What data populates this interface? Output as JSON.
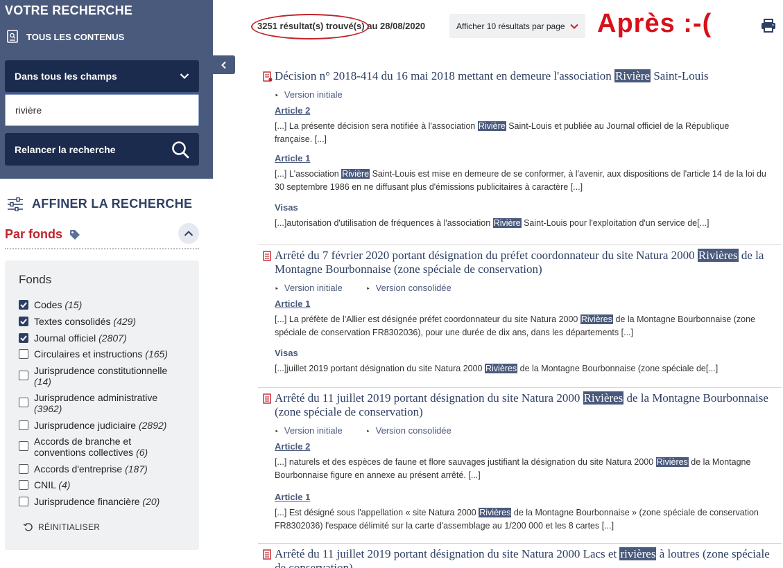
{
  "sidebar": {
    "title": "VOTRE RECHERCHE",
    "scope_label": "TOUS LES CONTENUS",
    "field_select": "Dans tous les champs",
    "query": "rivière",
    "relaunch_label": "Relancer la recherche",
    "refine_title": "AFFINER LA RECHERCHE",
    "section_title": "Par fonds",
    "fonds_title": "Fonds",
    "fonds": [
      {
        "label": "Codes",
        "count": "(15)",
        "checked": true
      },
      {
        "label": "Textes consolidés",
        "count": "(429)",
        "checked": true
      },
      {
        "label": "Journal officiel",
        "count": "(2807)",
        "checked": true
      },
      {
        "label": "Circulaires et instructions",
        "count": "(165)",
        "checked": false
      },
      {
        "label": "Jurisprudence constitutionnelle",
        "count": "(14)",
        "checked": false
      },
      {
        "label": "Jurisprudence administrative",
        "count": "(3962)",
        "checked": false
      },
      {
        "label": "Jurisprudence judiciaire",
        "count": "(2892)",
        "checked": false
      },
      {
        "label": "Accords de branche et conventions collectives",
        "count": "(6)",
        "checked": false
      },
      {
        "label": "Accords d'entreprise",
        "count": "(187)",
        "checked": false
      },
      {
        "label": "CNIL",
        "count": "(4)",
        "checked": false
      },
      {
        "label": "Jurisprudence financière",
        "count": "(20)",
        "checked": false
      }
    ],
    "reset_label": "RÉINITIALISER"
  },
  "topbar": {
    "count_text": "3251 résultat(s) trouvé(s)",
    "date_text": " au 28/08/2020",
    "per_page": "Afficher 10 résultats par page",
    "annotation": "Après :-("
  },
  "results": [
    {
      "title_a": "Décision n° 2018-414 du 16 mai 2018 mettant en demeure l'association ",
      "title_hl": "Rivière",
      "title_b": " Saint-Louis",
      "versions": [
        "Version initiale"
      ],
      "sections": [
        {
          "label": "Article 2",
          "type": "article",
          "a": "[...] La présente décision sera notifiée à l'association ",
          "hl": "Rivière",
          "b": " Saint-Louis et publiée au Journal officiel de la République française. [...]"
        },
        {
          "label": "Article 1",
          "type": "article",
          "a": "[...] L'association ",
          "hl": "Rivière",
          "b": " Saint-Louis est mise en demeure de se conformer, à l'avenir, aux dispositions de l'article 14 de la loi du 30 septembre 1986 en ne diffusant plus d'émissions publicitaires à caractère [...]"
        },
        {
          "label": "Visas",
          "type": "visa",
          "a": "[...]autorisation d'utilisation de fréquences à l'association ",
          "hl": "Rivière",
          "b": " Saint-Louis pour l'exploitation d'un service de[...]"
        }
      ]
    },
    {
      "title_a": "Arrêté du 7 février 2020 portant désignation du préfet coordonnateur du site Natura 2000 ",
      "title_hl": "Rivières",
      "title_b": " de la Montagne Bourbonnaise (zone spéciale de conservation)",
      "versions": [
        "Version initiale",
        "Version consolidée"
      ],
      "sections": [
        {
          "label": "Article 1",
          "type": "article",
          "a": "[...] La préfète de l'Allier est désignée préfet coordonnateur du site Natura 2000 ",
          "hl": "Rivières",
          "b": " de la Montagne Bourbonnaise (zone spéciale de conservation FR8302036), pour une durée de dix ans, dans les départements [...]"
        },
        {
          "label": "Visas",
          "type": "visa",
          "a": "[...]juillet 2019 portant désignation du site Natura 2000 ",
          "hl": "Rivières",
          "b": " de la Montagne Bourbonnaise (zone spéciale de[...]"
        }
      ]
    },
    {
      "title_a": "Arrêté du 11 juillet 2019 portant désignation du site Natura 2000 ",
      "title_hl": "Rivières",
      "title_b": " de la Montagne Bourbonnaise (zone spéciale de conservation)",
      "versions": [
        "Version initiale",
        "Version consolidée"
      ],
      "sections": [
        {
          "label": "Article 2",
          "type": "article",
          "a": "[...] naturels et des espèces de faune et flore sauvages justifiant la désignation du site Natura 2000 ",
          "hl": "Rivières",
          "b": " de la Montagne Bourbonnaise figure en annexe au présent arrêté. [...]"
        },
        {
          "label": "Article 1",
          "type": "article",
          "a": "[...] Est désigné sous l'appellation « site Natura 2000 ",
          "hl": "Rivières",
          "b": " de la Montagne Bourbonnaise » (zone spéciale de conservation FR8302036) l'espace délimité sur la carte d'assemblage au 1/200 000 et les 8 cartes [...]"
        }
      ]
    },
    {
      "title_a": "Arrêté du 11 juillet 2019 portant désignation du site Natura 2000 Lacs et ",
      "title_hl": "rivières",
      "title_b": " à loutres (zone spéciale de conservation)",
      "versions": [],
      "sections": []
    }
  ]
}
